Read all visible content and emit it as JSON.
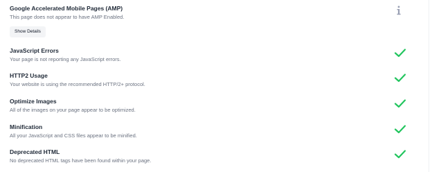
{
  "audit": {
    "amp": {
      "title": "Google Accelerated Mobile Pages (AMP)",
      "description": "This page does not appear to have AMP Enabled.",
      "details_label": "Show Details",
      "status_icon": "info-icon"
    },
    "items": [
      {
        "title": "JavaScript Errors",
        "description": "Your page is not reporting any JavaScript errors.",
        "status_icon": "checkmark-icon"
      },
      {
        "title": "HTTP2 Usage",
        "description": "Your website is using the recommended HTTP/2+ protocol.",
        "status_icon": "checkmark-icon"
      },
      {
        "title": "Optimize Images",
        "description": "All of the images on your page appear to be optimized.",
        "status_icon": "checkmark-icon"
      },
      {
        "title": "Minification",
        "description": "All your JavaScript and CSS files appear to be minified.",
        "status_icon": "checkmark-icon"
      },
      {
        "title": "Deprecated HTML",
        "description": "No deprecated HTML tags have been found within your page.",
        "status_icon": "checkmark-icon"
      }
    ]
  },
  "colors": {
    "pass": "#22c55e",
    "info": "#9aa0b4",
    "title": "#1f2937",
    "description": "#6b7280"
  }
}
